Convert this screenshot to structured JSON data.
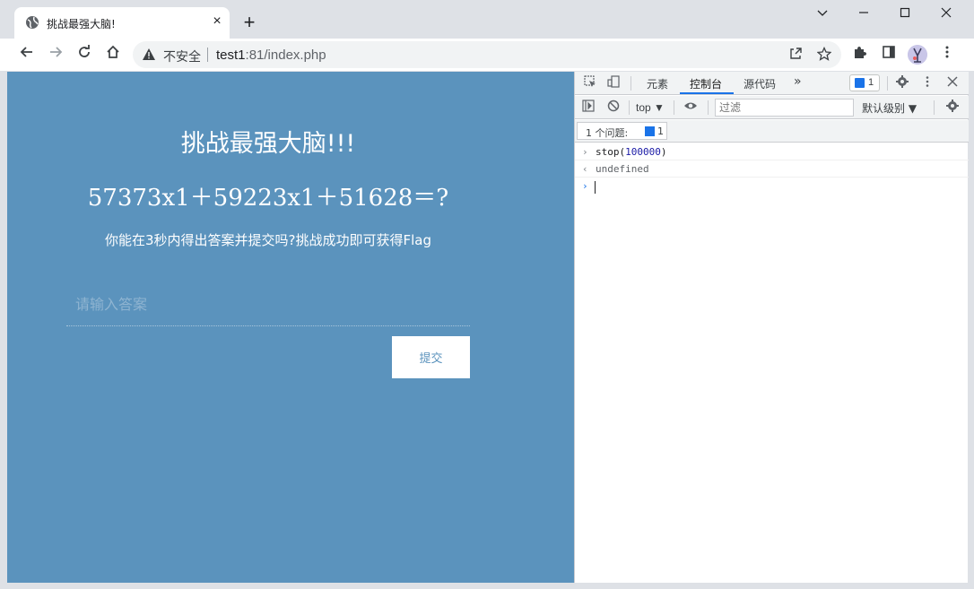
{
  "tab": {
    "title": "挑战最强大脑!",
    "close_glyph": "×"
  },
  "new_tab_glyph": "+",
  "window_controls": {
    "chevron": "⌵",
    "minimize": "—",
    "maximize": "☐",
    "close": "✕"
  },
  "toolbar": {
    "back_glyph": "←",
    "forward_glyph": "→",
    "reload_glyph": "↻",
    "home_glyph": "⌂",
    "security_label": "不安全",
    "url_host": "test1",
    "url_path": ":81/index.php"
  },
  "page": {
    "title": "挑战最强大脑!!!",
    "equation": "57373x1＋59223x1＋51628＝?",
    "subtext": "你能在3秒内得出答案并提交吗?挑战成功即可获得Flag",
    "answer_placeholder": "请输入答案",
    "submit_label": "提交"
  },
  "devtools": {
    "tabs": [
      "元素",
      "控制台",
      "源代码"
    ],
    "more_glyph": "»",
    "issue_badge_count": "1",
    "context": "top ▼",
    "filter_placeholder": "过滤",
    "levels_label": "默认级别 ▼",
    "issues_label": "1 个问题:",
    "issues_count": "1",
    "console": {
      "input_fn": "stop(",
      "input_num": "100000",
      "input_close": ")",
      "output": "undefined",
      "prompt_glyph": "›",
      "result_glyph": "‹"
    }
  },
  "colors": {
    "page_background": "#5b93bd",
    "accent_blue": "#1a73e8"
  },
  "icons": [
    "globe-icon",
    "warning-icon",
    "share-icon",
    "star-icon",
    "puzzle-icon",
    "sidepanel-icon",
    "kebab-menu-icon",
    "inspect-icon",
    "device-icon",
    "gear-icon",
    "clear-console-icon",
    "eye-icon",
    "sidebar-toggle-icon"
  ]
}
